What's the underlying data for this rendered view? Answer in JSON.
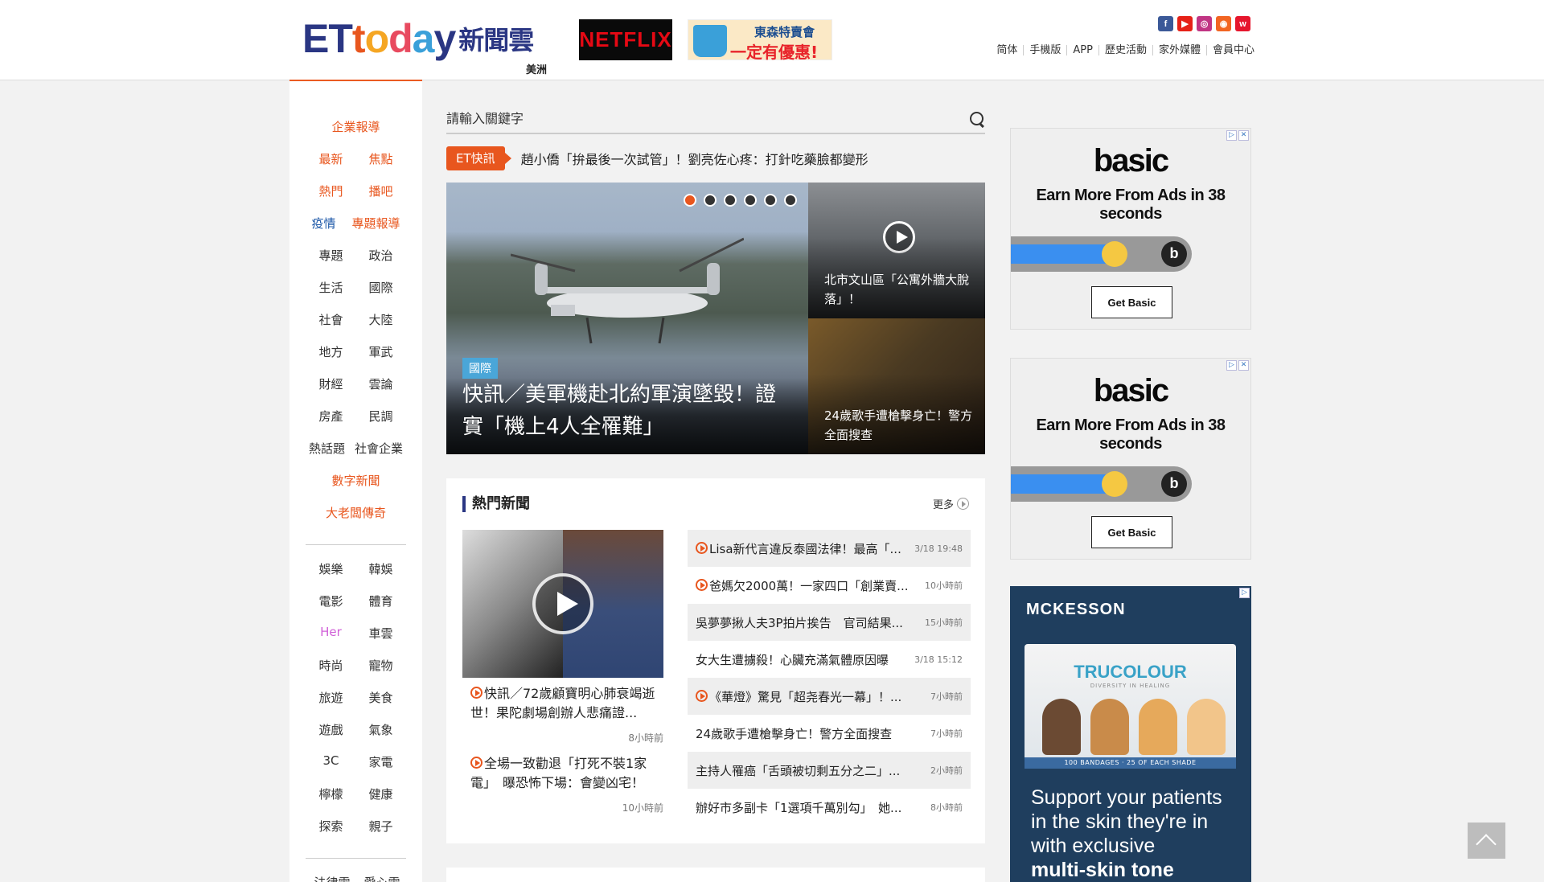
{
  "header": {
    "logo": {
      "letters": [
        "E",
        "T",
        "t",
        "o",
        "d",
        "a",
        "y"
      ],
      "cn": "新聞雲",
      "edition": "美洲"
    },
    "netflix_ad": "NETFLIX",
    "tosen_ad": {
      "line1": "東森特賣會",
      "line2": "一定有優惠!"
    },
    "social_icons": [
      "facebook-icon",
      "youtube-icon",
      "instagram-icon",
      "rss-icon",
      "weibo-icon"
    ],
    "top_links": [
      "简体",
      "手機版",
      "APP",
      "歷史活動",
      "家外媒體",
      "會員中心"
    ]
  },
  "sidebar": {
    "rows": [
      [
        "企業報導"
      ],
      [
        "最新",
        "焦點"
      ],
      [
        "熱門",
        "播吧"
      ],
      [
        "疫情",
        "專題報導"
      ],
      [
        "專題",
        "政治"
      ],
      [
        "生活",
        "國際"
      ],
      [
        "社會",
        "大陸"
      ],
      [
        "地方",
        "軍武"
      ],
      [
        "財經",
        "雲論"
      ],
      [
        "房產",
        "民調"
      ],
      [
        "熱話題",
        "社會企業"
      ],
      [
        "數字新聞"
      ],
      [
        "大老闆傳奇"
      ],
      [
        "娛樂",
        "韓娛"
      ],
      [
        "電影",
        "體育"
      ],
      [
        "Her",
        "車雲"
      ],
      [
        "時尚",
        "寵物"
      ],
      [
        "旅遊",
        "美食"
      ],
      [
        "遊戲",
        "氣象"
      ],
      [
        "3C",
        "家電"
      ],
      [
        "檸檬",
        "健康"
      ],
      [
        "探索",
        "親子"
      ],
      [
        "法律雲",
        "愛心雲"
      ]
    ]
  },
  "search": {
    "placeholder": "請輸入關鍵字"
  },
  "flash": {
    "badge": "ET快訊",
    "text": "趙小僑「拚最後一次試管」！劉亮佐心疼：打針吃藥臉都變形"
  },
  "carousel": {
    "tag": "國際",
    "title": "快訊／美軍機赴北約軍演墜毀！證實「機上4人全罹難」",
    "dots": 6,
    "active_dot": 0
  },
  "side_cards": [
    {
      "caption": "北市文山區「公寓外牆大脫落」！"
    },
    {
      "caption": "24歲歌手遭槍擊身亡！警方全面搜查"
    }
  ],
  "hot": {
    "title": "熱門新聞",
    "more": "更多",
    "left_items": [
      {
        "title": "快訊／72歲顧寶明心肺衰竭逝世！果陀劇場創辦人悲痛證...",
        "time": "8小時前"
      },
      {
        "title": "全場一致勸退「打死不裝1家電」　曝恐怖下場：會變凶宅！",
        "time": "10小時前"
      }
    ],
    "list": [
      {
        "title": "Lisa新代言違反泰國法律！最高「...",
        "time": "3/18 19:48",
        "video": true
      },
      {
        "title": "爸媽欠2000萬！一家四口「創業賣...",
        "time": "10小時前",
        "video": true
      },
      {
        "title": "吳夢夢揪人夫3P拍片挨告　官司結果...",
        "time": "15小時前",
        "video": false
      },
      {
        "title": "女大生遭擄殺！心臟充滿氣體原因曝",
        "time": "3/18 15:12",
        "video": false
      },
      {
        "title": "《華燈》驚見「超尧春光一幕」！...",
        "time": "7小時前",
        "video": true
      },
      {
        "title": "24歲歌手遭槍擊身亡！警方全面搜查",
        "time": "7小時前",
        "video": false
      },
      {
        "title": "主持人罹癌「舌頭被切剩五分之二」...",
        "time": "2小時前",
        "video": false
      },
      {
        "title": "辦好市多副卡「1選項千萬別勾」　她...",
        "time": "8小時前",
        "video": false
      }
    ]
  },
  "ads": [
    {
      "brand": "basic",
      "headline": "Earn More From Ads in 38 seconds",
      "button": "Get Basic"
    },
    {
      "brand": "basic",
      "headline": "Earn More From Ads in 38 seconds",
      "button": "Get Basic"
    }
  ],
  "ad3": {
    "brand": "MCKESSON",
    "product": "TRUCOLOUR",
    "product_sub": "DIVERSITY IN HEALING",
    "strip": "100 BANDAGES · 25 OF EACH SHADE",
    "text": "Support your patients in the skin they're in with exclusive",
    "text_bold": "multi-skin tone"
  },
  "colors": {
    "accent": "#e8561e",
    "brand_blue": "#2a3683",
    "nav_blue": "#1a56a7",
    "her_pink": "#d05fd7"
  }
}
